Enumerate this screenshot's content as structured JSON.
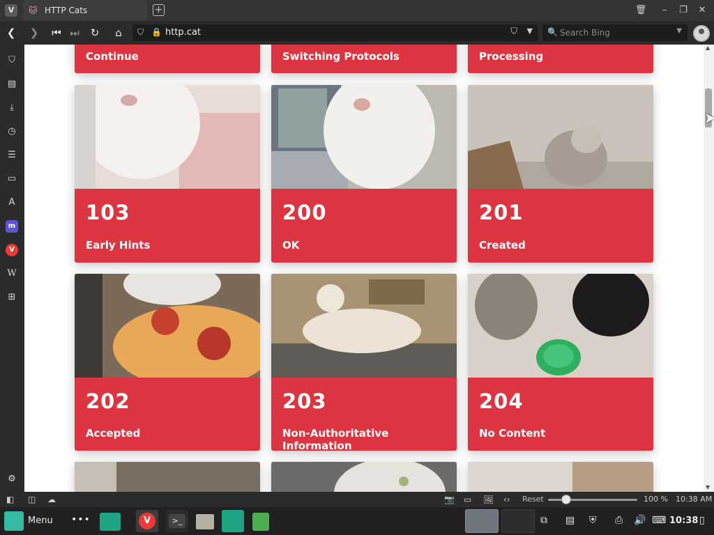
{
  "tab": {
    "title": "HTTP Cats"
  },
  "browser": {
    "logo": "V"
  },
  "address": {
    "url": "http.cat"
  },
  "search": {
    "placeholder": "Search Bing"
  },
  "top_partial_cards": [
    {
      "name": "Continue"
    },
    {
      "name": "Switching Protocols"
    },
    {
      "name": "Processing"
    }
  ],
  "cards": [
    {
      "code": "103",
      "name": "Early Hints",
      "img_color": "#d8cfcc"
    },
    {
      "code": "200",
      "name": "OK",
      "img_color": "#c9c4bc"
    },
    {
      "code": "201",
      "name": "Created",
      "img_color": "#b9b3ac"
    },
    {
      "code": "202",
      "name": "Accepted",
      "img_color": "#c0663a"
    },
    {
      "code": "203",
      "name": "Non-Authoritative Information",
      "img_color": "#8c8a7d"
    },
    {
      "code": "204",
      "name": "No Content",
      "img_color": "#bdb8b0"
    }
  ],
  "status": {
    "reset_label": "Reset",
    "zoom": "100 %",
    "time": "10:38 AM",
    "zoom_level": 1.0
  },
  "taskbar": {
    "menu_label": "Menu",
    "clock": "10:38"
  },
  "colors": {
    "card_red": "#dd3441",
    "chrome_dark": "#2b2b2b"
  }
}
